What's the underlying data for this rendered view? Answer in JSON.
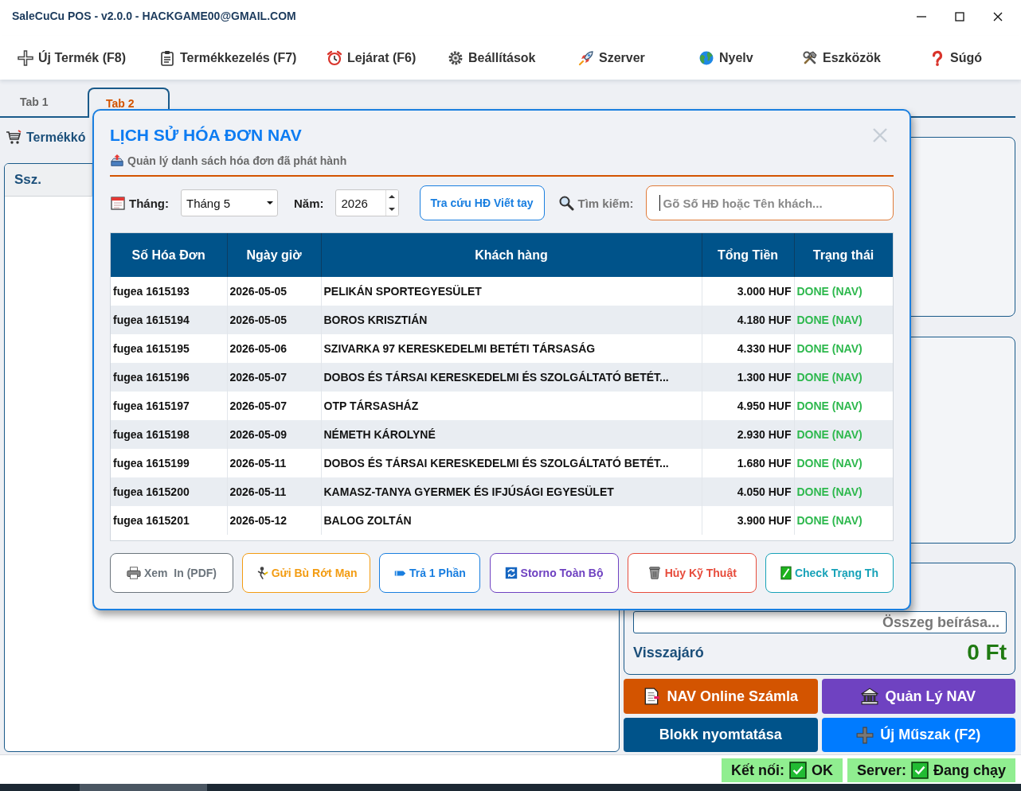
{
  "window": {
    "title": "SaleCuCu POS - v2.0.0 - HACKGAME00@GMAIL.COM"
  },
  "menu": [
    "Új Termék (F8)",
    "Termékkezelés (F7)",
    "Lejárat (F6)",
    "Beállítások",
    "Szerver",
    "Nyelv",
    "Eszközök",
    "Súgó"
  ],
  "tabs": [
    {
      "label": "Tab 1",
      "selected": false
    },
    {
      "label": "Tab 2",
      "selected": true
    }
  ],
  "product_panel": {
    "label": "Termékkó",
    "columns": [
      "Ssz."
    ]
  },
  "payment_panel": {
    "amount_field": {
      "placeholder": "Összeg beírása..."
    },
    "change_label": "Visszajáró",
    "change_value": "0 Ft"
  },
  "action_buttons": [
    {
      "label": "NAV Online Számla",
      "color": "#d35400"
    },
    {
      "label": "Quản Lý NAV",
      "color": "#6f42c1"
    },
    {
      "label": "Blokk nyomtatása",
      "color": "#00538a"
    },
    {
      "label": "Új Műszak (F2)",
      "color": "#007bff"
    }
  ],
  "status_bar": [
    {
      "label": "Kết nối:",
      "value": "OK",
      "ok": true
    },
    {
      "label": "Server:",
      "value": "Đang chạy",
      "ok": true
    }
  ],
  "dialog": {
    "title": "LỊCH SỬ HÓA ĐƠN NAV",
    "subtitle": "Quản lý danh sách hóa đơn đã phát hành",
    "month": {
      "label": "Tháng:",
      "value": "Tháng 5"
    },
    "year": {
      "label": "Năm:",
      "value": "2026"
    },
    "lookup_button": "Tra cứu HĐ Viết tay",
    "search": {
      "label": "Tìm kiếm:",
      "placeholder": "Gõ Số HĐ hoặc Tên khách...",
      "focused": true
    },
    "table": {
      "columns": [
        "Số Hóa Đơn",
        "Ngày giờ",
        "Khách hàng",
        "Tổng Tiền",
        "Trạng thái"
      ],
      "rows": [
        [
          "fugea 1615193",
          "2026-05-05",
          "PELIKÁN SPORTEGYESÜLET",
          "3.000 HUF",
          "DONE (NAV)"
        ],
        [
          "fugea 1615194",
          "2026-05-05",
          "BOROS KRISZTIÁN",
          "4.180 HUF",
          "DONE (NAV)"
        ],
        [
          "fugea 1615195",
          "2026-05-06",
          "SZIVARKA 97 KERESKEDELMI BETÉTI TÁRSASÁG",
          "4.330 HUF",
          "DONE (NAV)"
        ],
        [
          "fugea 1615196",
          "2026-05-07",
          "DOBOS ÉS TÁRSAI KERESKEDELMI ÉS SZOLGÁLTATÓ BETÉT...",
          "1.300 HUF",
          "DONE (NAV)"
        ],
        [
          "fugea 1615197",
          "2026-05-07",
          "OTP TÁRSASHÁZ",
          "4.950 HUF",
          "DONE (NAV)"
        ],
        [
          "fugea 1615198",
          "2026-05-09",
          "NÉMETH KÁROLYNÉ",
          "2.930 HUF",
          "DONE (NAV)"
        ],
        [
          "fugea 1615199",
          "2026-05-11",
          "DOBOS ÉS TÁRSAI KERESKEDELMI ÉS SZOLGÁLTATÓ BETÉT...",
          "1.680 HUF",
          "DONE (NAV)"
        ],
        [
          "fugea 1615200",
          "2026-05-11",
          "KAMASZ-TANYA GYERMEK ÉS IFJÚSÁGI EGYESÜLET",
          "4.050 HUF",
          "DONE (NAV)"
        ],
        [
          "fugea 1615201",
          "2026-05-12",
          "BALOG ZOLTÁN",
          "3.900 HUF",
          "DONE (NAV)"
        ]
      ]
    },
    "buttons": [
      {
        "label": "Xem  In (PDF)",
        "color": "#6c757d"
      },
      {
        "label": "Gửi Bù Rớt Mạn",
        "color": "#f39c12"
      },
      {
        "label": "Trả 1 Phần",
        "color": "#1a7fe0"
      },
      {
        "label": "Storno Toàn Bộ",
        "color": "#6f42c1"
      },
      {
        "label": "Hủy Kỹ Thuật",
        "color": "#e74c3c"
      },
      {
        "label": "Check Trạng Th",
        "color": "#17a2b8"
      }
    ]
  }
}
